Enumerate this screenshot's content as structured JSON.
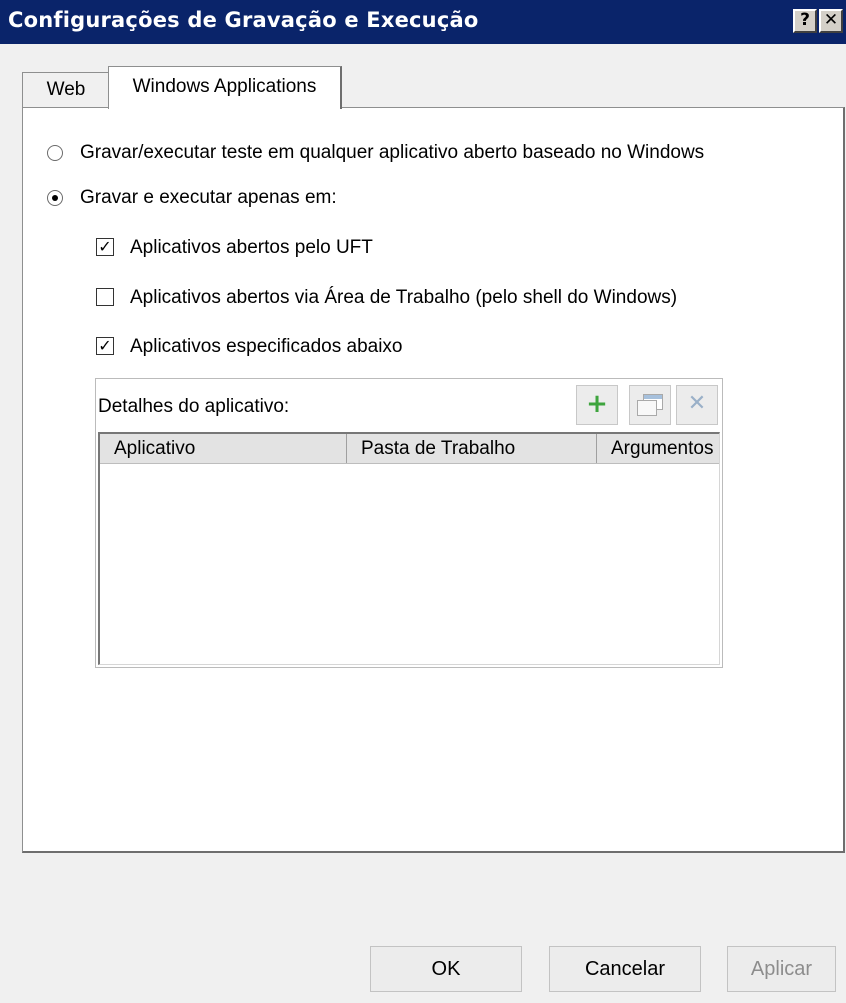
{
  "window": {
    "title": "Configurações de Gravação e Execução",
    "help_glyph": "?",
    "close_glyph": "✕"
  },
  "tabs": [
    {
      "label": "Web",
      "selected": false
    },
    {
      "label": "Windows Applications",
      "selected": true
    }
  ],
  "options": {
    "record_any": {
      "label": "Gravar/executar teste em qualquer aplicativo aberto baseado no Windows",
      "selected": false
    },
    "record_only": {
      "label": "Gravar e executar apenas em:",
      "selected": true
    }
  },
  "checkboxes": [
    {
      "label": "Aplicativos abertos pelo UFT",
      "checked": true
    },
    {
      "label": "Aplicativos abertos via Área de Trabalho (pelo shell do Windows)",
      "checked": false
    },
    {
      "label": "Aplicativos especificados abaixo",
      "checked": true
    }
  ],
  "app_details": {
    "label": "Detalhes do aplicativo:",
    "toolbar": {
      "add_icon": "plus-icon",
      "properties_icon": "properties-icon",
      "delete_icon": "delete-icon"
    },
    "columns": [
      "Aplicativo",
      "Pasta de Trabalho",
      "Argumentos"
    ],
    "rows": []
  },
  "buttons": {
    "ok": "OK",
    "cancel": "Cancelar",
    "apply": "Aplicar"
  },
  "colors": {
    "titlebar": "#0a246a",
    "add_icon": "#3ea43e",
    "disabled_text": "#8d8d8d"
  }
}
